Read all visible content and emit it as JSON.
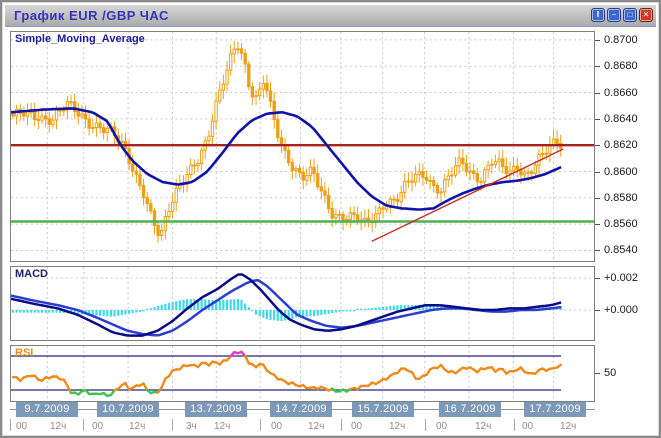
{
  "window": {
    "title": "График EUR /GBP  ЧАС",
    "buttons": [
      {
        "name": "pause",
        "glyph": "‖"
      },
      {
        "name": "minimize",
        "glyph": "−"
      },
      {
        "name": "maximize",
        "glyph": "□"
      },
      {
        "name": "close",
        "glyph": "✕"
      }
    ]
  },
  "colors": {
    "candle": "#eda016",
    "sma": "#1113a8",
    "resistance": "#a6231c",
    "support": "#4db34d",
    "trendline": "#c03028",
    "macd_line": "#0b0b8a",
    "signal_line": "#2a3ed0",
    "histogram": "#3fd9e8",
    "rsi_line": "#ef8a1a",
    "rsi_overbought": "#e33bc3",
    "rsi_oversold": "#3bc34b",
    "rsi_band": "#26267e",
    "grid": "#c9c9c9",
    "titlebar_text": "#3535bb",
    "date_box_bg": "#7d99b8",
    "date_box_text": "#ffffff",
    "time_text": "#8e8e8e",
    "axis_text": "#1a1a1a",
    "button_blue": "#3c68cc",
    "button_red": "#c93a28"
  },
  "x_axis": {
    "right": 593,
    "days": [
      {
        "date": "9.7.2009",
        "x0": 8,
        "x1": 81,
        "times": [
          {
            "label": "00",
            "dx": 6
          },
          {
            "label": "12ч",
            "dx": 40
          }
        ]
      },
      {
        "date": "10.7.2009",
        "x0": 81,
        "x1": 170,
        "times": [
          {
            "label": "00",
            "dx": 9
          },
          {
            "label": "12ч",
            "dx": 46
          }
        ]
      },
      {
        "date": "13.7.2009",
        "x0": 170,
        "x1": 258,
        "times": [
          {
            "label": "3ч",
            "dx": 14
          },
          {
            "label": "12ч",
            "dx": 42
          }
        ]
      },
      {
        "date": "14.7.2009",
        "x0": 258,
        "x1": 339,
        "times": [
          {
            "label": "00",
            "dx": 11
          },
          {
            "label": "12ч",
            "dx": 48
          }
        ]
      },
      {
        "date": "15.7.2009",
        "x0": 339,
        "x1": 423,
        "times": [
          {
            "label": "00",
            "dx": 10
          },
          {
            "label": "12ч",
            "dx": 48
          }
        ]
      },
      {
        "date": "16.7.2009",
        "x0": 423,
        "x1": 512,
        "times": [
          {
            "label": "00",
            "dx": 11
          },
          {
            "label": "12ч",
            "dx": 50
          }
        ]
      },
      {
        "date": "17.7.2009",
        "x0": 512,
        "x1": 593,
        "times": [
          {
            "label": "00",
            "dx": 8
          },
          {
            "label": "12ч",
            "dx": 46
          }
        ]
      }
    ]
  },
  "chart_data": [
    {
      "type": "candlestick",
      "title": "Simple_Moving_Average",
      "symbol": "EUR/GBP",
      "timeframe": "1 hour",
      "y_axis": {
        "min": 0.8532,
        "max": 0.8706,
        "ticks": [
          {
            "label": "0.8700",
            "value": 0.87
          },
          {
            "label": "0.8680",
            "value": 0.868
          },
          {
            "label": "0.8660",
            "value": 0.866
          },
          {
            "label": "0.8640",
            "value": 0.864
          },
          {
            "label": "0.8620",
            "value": 0.862
          },
          {
            "label": "0.8600",
            "value": 0.86
          },
          {
            "label": "0.8580",
            "value": 0.858
          },
          {
            "label": "0.8560",
            "value": 0.856
          },
          {
            "label": "0.8540",
            "value": 0.854
          }
        ]
      },
      "levels": {
        "resistance": 0.862,
        "support": 0.8562
      },
      "trendline": {
        "from": [
          370,
          0.8547
        ],
        "to": [
          562,
          0.8617
        ]
      },
      "price_path": [
        [
          8,
          0.8638
        ],
        [
          20,
          0.8642
        ],
        [
          35,
          0.8645
        ],
        [
          50,
          0.864
        ],
        [
          65,
          0.8648
        ],
        [
          80,
          0.8643
        ],
        [
          95,
          0.8636
        ],
        [
          110,
          0.8626
        ],
        [
          122,
          0.8616
        ],
        [
          132,
          0.8602
        ],
        [
          142,
          0.8585
        ],
        [
          150,
          0.8562
        ],
        [
          158,
          0.8546
        ],
        [
          166,
          0.8568
        ],
        [
          176,
          0.859
        ],
        [
          186,
          0.8604
        ],
        [
          196,
          0.861
        ],
        [
          205,
          0.862
        ],
        [
          214,
          0.8648
        ],
        [
          222,
          0.8672
        ],
        [
          230,
          0.8694
        ],
        [
          235,
          0.8702
        ],
        [
          241,
          0.8688
        ],
        [
          248,
          0.866
        ],
        [
          255,
          0.865
        ],
        [
          262,
          0.8668
        ],
        [
          270,
          0.8645
        ],
        [
          280,
          0.8622
        ],
        [
          290,
          0.8606
        ],
        [
          300,
          0.8592
        ],
        [
          310,
          0.8597
        ],
        [
          320,
          0.8585
        ],
        [
          330,
          0.8572
        ],
        [
          340,
          0.8566
        ],
        [
          352,
          0.8562
        ],
        [
          364,
          0.8559
        ],
        [
          374,
          0.857
        ],
        [
          384,
          0.858
        ],
        [
          394,
          0.8576
        ],
        [
          404,
          0.8586
        ],
        [
          414,
          0.8596
        ],
        [
          424,
          0.8601
        ],
        [
          432,
          0.8591
        ],
        [
          440,
          0.8586
        ],
        [
          450,
          0.8596
        ],
        [
          460,
          0.8606
        ],
        [
          470,
          0.86
        ],
        [
          480,
          0.8598
        ],
        [
          490,
          0.8608
        ],
        [
          500,
          0.8601
        ],
        [
          508,
          0.8596
        ],
        [
          516,
          0.8605
        ],
        [
          524,
          0.86
        ],
        [
          532,
          0.8606
        ],
        [
          540,
          0.8611
        ],
        [
          548,
          0.8615
        ],
        [
          556,
          0.862
        ],
        [
          562,
          0.8618
        ]
      ],
      "sma": [
        [
          8,
          0.8645
        ],
        [
          40,
          0.8647
        ],
        [
          70,
          0.8648
        ],
        [
          90,
          0.8645
        ],
        [
          105,
          0.8638
        ],
        [
          118,
          0.862
        ],
        [
          130,
          0.8608
        ],
        [
          145,
          0.8598
        ],
        [
          160,
          0.8592
        ],
        [
          175,
          0.859
        ],
        [
          190,
          0.8592
        ],
        [
          205,
          0.86
        ],
        [
          220,
          0.8614
        ],
        [
          235,
          0.8629
        ],
        [
          250,
          0.8639
        ],
        [
          265,
          0.8644
        ],
        [
          280,
          0.8645
        ],
        [
          295,
          0.8642
        ],
        [
          310,
          0.8634
        ],
        [
          325,
          0.862
        ],
        [
          340,
          0.8606
        ],
        [
          355,
          0.8592
        ],
        [
          370,
          0.8581
        ],
        [
          385,
          0.8574
        ],
        [
          400,
          0.8572
        ],
        [
          418,
          0.8571
        ],
        [
          432,
          0.8572
        ],
        [
          446,
          0.8578
        ],
        [
          460,
          0.8583
        ],
        [
          474,
          0.8587
        ],
        [
          488,
          0.859
        ],
        [
          502,
          0.8592
        ],
        [
          516,
          0.8593
        ],
        [
          530,
          0.8595
        ],
        [
          544,
          0.8598
        ],
        [
          556,
          0.8602
        ],
        [
          562,
          0.8604
        ]
      ]
    },
    {
      "type": "line",
      "title": "MACD",
      "y_axis": {
        "ticks": [
          {
            "label": "+0.002",
            "value": 0.002
          },
          {
            "label": "+0.000",
            "value": 0.0
          }
        ]
      },
      "series": [
        {
          "name": "macd",
          "points": [
            [
              8,
              0.0007
            ],
            [
              30,
              0.0004
            ],
            [
              55,
              0.0001
            ],
            [
              75,
              -0.0003
            ],
            [
              95,
              -0.0009
            ],
            [
              110,
              -0.0014
            ],
            [
              125,
              -0.0016
            ],
            [
              140,
              -0.0016
            ],
            [
              155,
              -0.0013
            ],
            [
              170,
              -0.0007
            ],
            [
              185,
              0.0001
            ],
            [
              200,
              0.0008
            ],
            [
              215,
              0.0013
            ],
            [
              228,
              0.0019
            ],
            [
              238,
              0.0023
            ],
            [
              248,
              0.0019
            ],
            [
              258,
              0.0013
            ],
            [
              268,
              0.0006
            ],
            [
              278,
              -0.0001
            ],
            [
              288,
              -0.0006
            ],
            [
              298,
              -0.0009
            ],
            [
              312,
              -0.0012
            ],
            [
              326,
              -0.0013
            ],
            [
              340,
              -0.0012
            ],
            [
              354,
              -0.001
            ],
            [
              368,
              -0.0007
            ],
            [
              382,
              -0.0004
            ],
            [
              396,
              -0.0001
            ],
            [
              410,
              0.0001
            ],
            [
              424,
              0.0003
            ],
            [
              438,
              0.0003
            ],
            [
              452,
              0.0002
            ],
            [
              466,
              0.0001
            ],
            [
              480,
              0.0
            ],
            [
              494,
              0.0
            ],
            [
              508,
              0.0001
            ],
            [
              522,
              0.0001
            ],
            [
              536,
              0.0002
            ],
            [
              550,
              0.0003
            ],
            [
              562,
              0.0005
            ]
          ]
        },
        {
          "name": "signal",
          "points": [
            [
              8,
              0.0009
            ],
            [
              30,
              0.0006
            ],
            [
              55,
              0.0003
            ],
            [
              75,
              0.0
            ],
            [
              95,
              -0.0005
            ],
            [
              110,
              -0.0009
            ],
            [
              125,
              -0.0013
            ],
            [
              140,
              -0.0015
            ],
            [
              155,
              -0.0016
            ],
            [
              170,
              -0.0013
            ],
            [
              185,
              -0.0007
            ],
            [
              200,
              0.0
            ],
            [
              215,
              0.0006
            ],
            [
              230,
              0.0012
            ],
            [
              245,
              0.0017
            ],
            [
              255,
              0.0019
            ],
            [
              265,
              0.0015
            ],
            [
              275,
              0.0009
            ],
            [
              285,
              0.0003
            ],
            [
              295,
              -0.0003
            ],
            [
              310,
              -0.0007
            ],
            [
              325,
              -0.001
            ],
            [
              340,
              -0.0011
            ],
            [
              355,
              -0.001
            ],
            [
              370,
              -0.0008
            ],
            [
              385,
              -0.0006
            ],
            [
              400,
              -0.0004
            ],
            [
              415,
              -0.0002
            ],
            [
              430,
              0.0
            ],
            [
              445,
              0.0001
            ],
            [
              460,
              0.0001
            ],
            [
              475,
              0.0
            ],
            [
              490,
              -0.0001
            ],
            [
              505,
              -0.0001
            ],
            [
              520,
              0.0
            ],
            [
              535,
              0.0
            ],
            [
              550,
              0.0001
            ],
            [
              562,
              0.0002
            ]
          ]
        }
      ],
      "histogram": "macd minus signal"
    },
    {
      "type": "line",
      "title": "RSI",
      "levels": {
        "overbought": 70,
        "oversold": 30
      },
      "y_axis": {
        "ticks": [
          {
            "label": "50",
            "value": 50
          }
        ]
      },
      "values": [
        [
          8,
          46
        ],
        [
          18,
          42
        ],
        [
          28,
          48
        ],
        [
          38,
          41
        ],
        [
          48,
          46
        ],
        [
          58,
          44
        ],
        [
          62,
          40
        ],
        [
          68,
          28
        ],
        [
          74,
          24
        ],
        [
          80,
          30
        ],
        [
          86,
          27
        ],
        [
          92,
          24
        ],
        [
          98,
          27
        ],
        [
          104,
          23
        ],
        [
          110,
          26
        ],
        [
          116,
          33
        ],
        [
          122,
          38
        ],
        [
          128,
          30
        ],
        [
          134,
          35
        ],
        [
          140,
          38
        ],
        [
          146,
          28
        ],
        [
          152,
          26
        ],
        [
          158,
          30
        ],
        [
          164,
          45
        ],
        [
          170,
          52
        ],
        [
          176,
          55
        ],
        [
          182,
          58
        ],
        [
          188,
          60
        ],
        [
          194,
          57
        ],
        [
          200,
          62
        ],
        [
          206,
          60
        ],
        [
          212,
          63
        ],
        [
          218,
          61
        ],
        [
          224,
          65
        ],
        [
          230,
          72
        ],
        [
          236,
          75
        ],
        [
          240,
          74
        ],
        [
          244,
          68
        ],
        [
          248,
          60
        ],
        [
          254,
          57
        ],
        [
          258,
          62
        ],
        [
          264,
          55
        ],
        [
          270,
          48
        ],
        [
          276,
          44
        ],
        [
          282,
          40
        ],
        [
          288,
          38
        ],
        [
          295,
          36
        ],
        [
          302,
          34
        ],
        [
          310,
          32
        ],
        [
          318,
          33
        ],
        [
          326,
          31
        ],
        [
          334,
          29
        ],
        [
          342,
          29
        ],
        [
          350,
          31
        ],
        [
          358,
          33
        ],
        [
          366,
          36
        ],
        [
          374,
          38
        ],
        [
          382,
          42
        ],
        [
          390,
          47
        ],
        [
          398,
          53
        ],
        [
          404,
          56
        ],
        [
          410,
          50
        ],
        [
          416,
          42
        ],
        [
          422,
          46
        ],
        [
          428,
          53
        ],
        [
          434,
          57
        ],
        [
          440,
          58
        ],
        [
          446,
          52
        ],
        [
          452,
          50
        ],
        [
          458,
          53
        ],
        [
          464,
          57
        ],
        [
          470,
          55
        ],
        [
          476,
          52
        ],
        [
          482,
          55
        ],
        [
          488,
          57
        ],
        [
          494,
          53
        ],
        [
          500,
          55
        ],
        [
          506,
          50
        ],
        [
          512,
          52
        ],
        [
          518,
          56
        ],
        [
          524,
          52
        ],
        [
          530,
          48
        ],
        [
          536,
          52
        ],
        [
          542,
          55
        ],
        [
          548,
          53
        ],
        [
          554,
          57
        ],
        [
          560,
          58
        ],
        [
          564,
          57
        ]
      ]
    }
  ]
}
